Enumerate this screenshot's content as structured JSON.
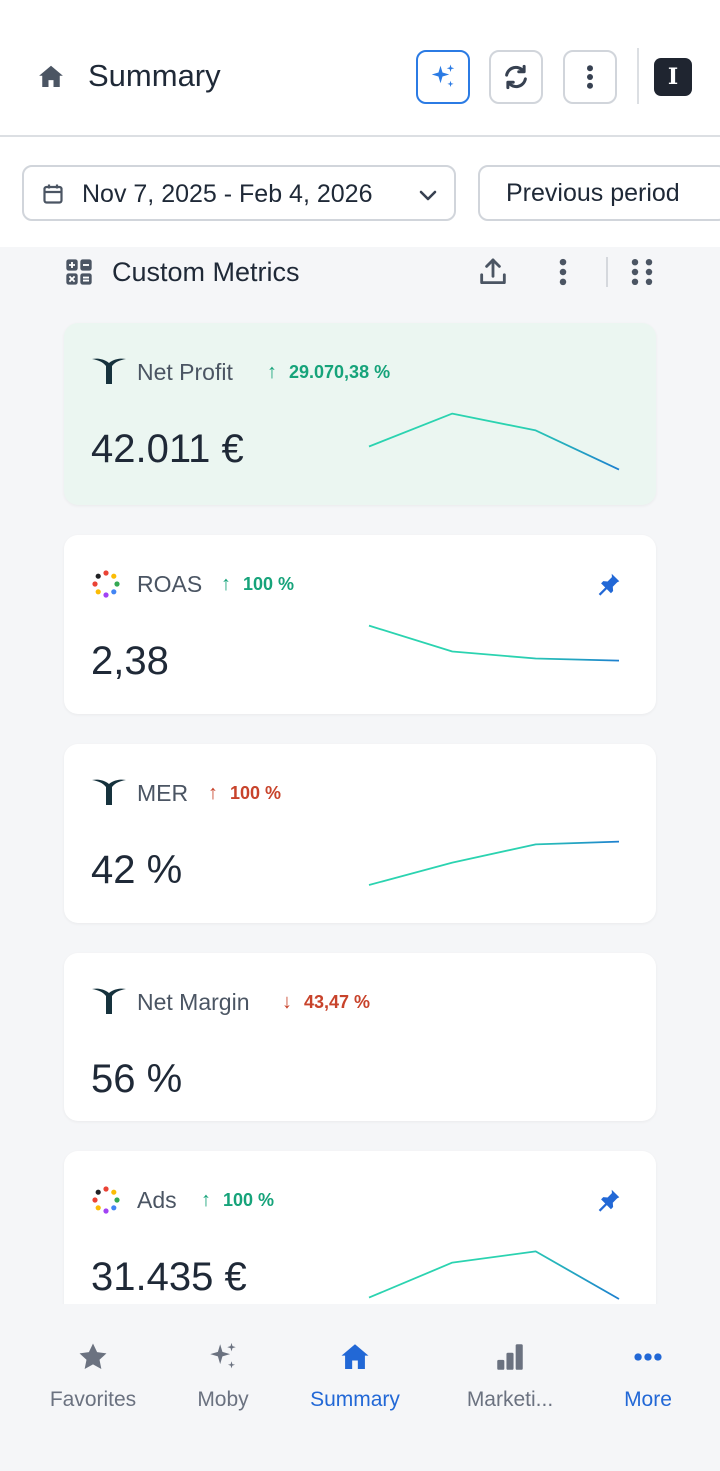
{
  "header": {
    "title": "Summary",
    "user_initial": "I"
  },
  "date_range": {
    "label": "Nov 7, 2025 - Feb 4, 2026",
    "compare_label": "Previous period"
  },
  "section": {
    "title": "Custom Metrics"
  },
  "cards": [
    {
      "name": "Net Profit",
      "change": "29.070,38 %",
      "direction": "up",
      "sentiment": "good",
      "value": "42.011 €",
      "icon": "triple-whale-logo",
      "pinned": false,
      "highlighted": true,
      "spark": [
        0.45,
        0.92,
        0.68,
        0.12
      ]
    },
    {
      "name": "ROAS",
      "change": "100 %",
      "direction": "up",
      "sentiment": "good",
      "value": "2,38",
      "icon": "multicolor-dots-logo",
      "pinned": true,
      "highlighted": false,
      "spark": [
        0.92,
        0.55,
        0.45,
        0.42
      ]
    },
    {
      "name": "MER",
      "change": "100 %",
      "direction": "up",
      "sentiment": "bad",
      "value": "42 %",
      "icon": "triple-whale-logo",
      "pinned": false,
      "highlighted": false,
      "spark": [
        0.2,
        0.52,
        0.78,
        0.82
      ]
    },
    {
      "name": "Net Margin",
      "change": "43,47 %",
      "direction": "down",
      "sentiment": "bad",
      "value": "56 %",
      "icon": "triple-whale-logo",
      "pinned": false,
      "highlighted": false,
      "spark": []
    },
    {
      "name": "Ads",
      "change": "100 %",
      "direction": "up",
      "sentiment": "good",
      "value": "31.435 €",
      "icon": "multicolor-dots-logo",
      "pinned": true,
      "highlighted": false,
      "spark": [
        0.12,
        0.62,
        0.78,
        0.1
      ]
    }
  ],
  "bottom_nav": [
    {
      "label": "Favorites",
      "icon": "star-icon",
      "active": false
    },
    {
      "label": "Moby",
      "icon": "sparkles-icon",
      "active": false
    },
    {
      "label": "Summary",
      "icon": "home-icon",
      "active": true
    },
    {
      "label": "Marketi...",
      "icon": "bar-chart-icon",
      "active": false
    },
    {
      "label": "More",
      "icon": "more-dots-icon",
      "active": false
    }
  ],
  "colors": {
    "accent": "#2268d6",
    "positive": "#16a37a",
    "negative": "#c8432b",
    "spark_start": "#2bd3b0",
    "spark_end": "#1d7fcf",
    "highlight_bg": "#ebf6f1"
  }
}
